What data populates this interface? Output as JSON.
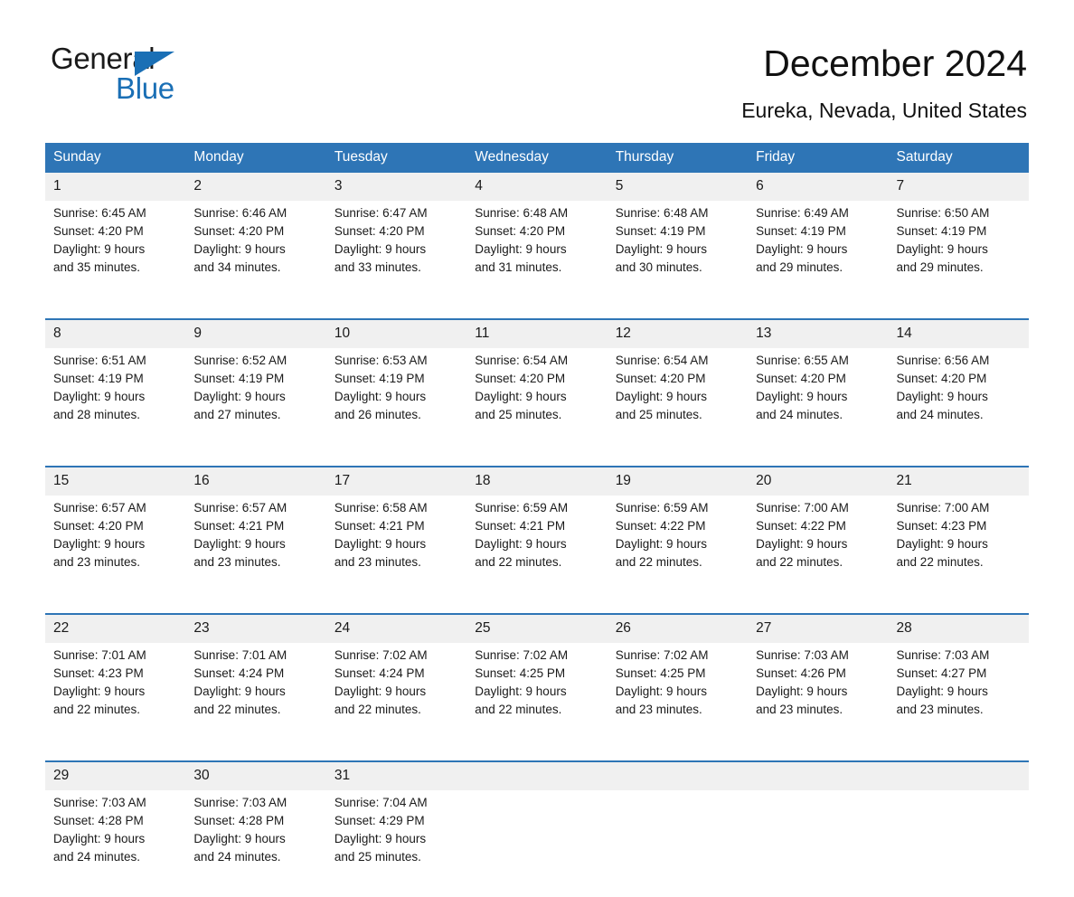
{
  "logo": {
    "word_one": "General",
    "word_two": "Blue",
    "triangle_color": "#1a6fb5"
  },
  "header": {
    "title": "December 2024",
    "subtitle": "Eureka, Nevada, United States",
    "accent_color": "#2e75b6",
    "daynum_band_color": "#f0f0f0"
  },
  "weekday_headers": [
    "Sunday",
    "Monday",
    "Tuesday",
    "Wednesday",
    "Thursday",
    "Friday",
    "Saturday"
  ],
  "weeks": [
    {
      "days": [
        {
          "number": "1",
          "sunrise": "Sunrise: 6:45 AM",
          "sunset": "Sunset: 4:20 PM",
          "daylight_1": "Daylight: 9 hours",
          "daylight_2": "and 35 minutes."
        },
        {
          "number": "2",
          "sunrise": "Sunrise: 6:46 AM",
          "sunset": "Sunset: 4:20 PM",
          "daylight_1": "Daylight: 9 hours",
          "daylight_2": "and 34 minutes."
        },
        {
          "number": "3",
          "sunrise": "Sunrise: 6:47 AM",
          "sunset": "Sunset: 4:20 PM",
          "daylight_1": "Daylight: 9 hours",
          "daylight_2": "and 33 minutes."
        },
        {
          "number": "4",
          "sunrise": "Sunrise: 6:48 AM",
          "sunset": "Sunset: 4:20 PM",
          "daylight_1": "Daylight: 9 hours",
          "daylight_2": "and 31 minutes."
        },
        {
          "number": "5",
          "sunrise": "Sunrise: 6:48 AM",
          "sunset": "Sunset: 4:19 PM",
          "daylight_1": "Daylight: 9 hours",
          "daylight_2": "and 30 minutes."
        },
        {
          "number": "6",
          "sunrise": "Sunrise: 6:49 AM",
          "sunset": "Sunset: 4:19 PM",
          "daylight_1": "Daylight: 9 hours",
          "daylight_2": "and 29 minutes."
        },
        {
          "number": "7",
          "sunrise": "Sunrise: 6:50 AM",
          "sunset": "Sunset: 4:19 PM",
          "daylight_1": "Daylight: 9 hours",
          "daylight_2": "and 29 minutes."
        }
      ]
    },
    {
      "days": [
        {
          "number": "8",
          "sunrise": "Sunrise: 6:51 AM",
          "sunset": "Sunset: 4:19 PM",
          "daylight_1": "Daylight: 9 hours",
          "daylight_2": "and 28 minutes."
        },
        {
          "number": "9",
          "sunrise": "Sunrise: 6:52 AM",
          "sunset": "Sunset: 4:19 PM",
          "daylight_1": "Daylight: 9 hours",
          "daylight_2": "and 27 minutes."
        },
        {
          "number": "10",
          "sunrise": "Sunrise: 6:53 AM",
          "sunset": "Sunset: 4:19 PM",
          "daylight_1": "Daylight: 9 hours",
          "daylight_2": "and 26 minutes."
        },
        {
          "number": "11",
          "sunrise": "Sunrise: 6:54 AM",
          "sunset": "Sunset: 4:20 PM",
          "daylight_1": "Daylight: 9 hours",
          "daylight_2": "and 25 minutes."
        },
        {
          "number": "12",
          "sunrise": "Sunrise: 6:54 AM",
          "sunset": "Sunset: 4:20 PM",
          "daylight_1": "Daylight: 9 hours",
          "daylight_2": "and 25 minutes."
        },
        {
          "number": "13",
          "sunrise": "Sunrise: 6:55 AM",
          "sunset": "Sunset: 4:20 PM",
          "daylight_1": "Daylight: 9 hours",
          "daylight_2": "and 24 minutes."
        },
        {
          "number": "14",
          "sunrise": "Sunrise: 6:56 AM",
          "sunset": "Sunset: 4:20 PM",
          "daylight_1": "Daylight: 9 hours",
          "daylight_2": "and 24 minutes."
        }
      ]
    },
    {
      "days": [
        {
          "number": "15",
          "sunrise": "Sunrise: 6:57 AM",
          "sunset": "Sunset: 4:20 PM",
          "daylight_1": "Daylight: 9 hours",
          "daylight_2": "and 23 minutes."
        },
        {
          "number": "16",
          "sunrise": "Sunrise: 6:57 AM",
          "sunset": "Sunset: 4:21 PM",
          "daylight_1": "Daylight: 9 hours",
          "daylight_2": "and 23 minutes."
        },
        {
          "number": "17",
          "sunrise": "Sunrise: 6:58 AM",
          "sunset": "Sunset: 4:21 PM",
          "daylight_1": "Daylight: 9 hours",
          "daylight_2": "and 23 minutes."
        },
        {
          "number": "18",
          "sunrise": "Sunrise: 6:59 AM",
          "sunset": "Sunset: 4:21 PM",
          "daylight_1": "Daylight: 9 hours",
          "daylight_2": "and 22 minutes."
        },
        {
          "number": "19",
          "sunrise": "Sunrise: 6:59 AM",
          "sunset": "Sunset: 4:22 PM",
          "daylight_1": "Daylight: 9 hours",
          "daylight_2": "and 22 minutes."
        },
        {
          "number": "20",
          "sunrise": "Sunrise: 7:00 AM",
          "sunset": "Sunset: 4:22 PM",
          "daylight_1": "Daylight: 9 hours",
          "daylight_2": "and 22 minutes."
        },
        {
          "number": "21",
          "sunrise": "Sunrise: 7:00 AM",
          "sunset": "Sunset: 4:23 PM",
          "daylight_1": "Daylight: 9 hours",
          "daylight_2": "and 22 minutes."
        }
      ]
    },
    {
      "days": [
        {
          "number": "22",
          "sunrise": "Sunrise: 7:01 AM",
          "sunset": "Sunset: 4:23 PM",
          "daylight_1": "Daylight: 9 hours",
          "daylight_2": "and 22 minutes."
        },
        {
          "number": "23",
          "sunrise": "Sunrise: 7:01 AM",
          "sunset": "Sunset: 4:24 PM",
          "daylight_1": "Daylight: 9 hours",
          "daylight_2": "and 22 minutes."
        },
        {
          "number": "24",
          "sunrise": "Sunrise: 7:02 AM",
          "sunset": "Sunset: 4:24 PM",
          "daylight_1": "Daylight: 9 hours",
          "daylight_2": "and 22 minutes."
        },
        {
          "number": "25",
          "sunrise": "Sunrise: 7:02 AM",
          "sunset": "Sunset: 4:25 PM",
          "daylight_1": "Daylight: 9 hours",
          "daylight_2": "and 22 minutes."
        },
        {
          "number": "26",
          "sunrise": "Sunrise: 7:02 AM",
          "sunset": "Sunset: 4:25 PM",
          "daylight_1": "Daylight: 9 hours",
          "daylight_2": "and 23 minutes."
        },
        {
          "number": "27",
          "sunrise": "Sunrise: 7:03 AM",
          "sunset": "Sunset: 4:26 PM",
          "daylight_1": "Daylight: 9 hours",
          "daylight_2": "and 23 minutes."
        },
        {
          "number": "28",
          "sunrise": "Sunrise: 7:03 AM",
          "sunset": "Sunset: 4:27 PM",
          "daylight_1": "Daylight: 9 hours",
          "daylight_2": "and 23 minutes."
        }
      ]
    },
    {
      "days": [
        {
          "number": "29",
          "sunrise": "Sunrise: 7:03 AM",
          "sunset": "Sunset: 4:28 PM",
          "daylight_1": "Daylight: 9 hours",
          "daylight_2": "and 24 minutes."
        },
        {
          "number": "30",
          "sunrise": "Sunrise: 7:03 AM",
          "sunset": "Sunset: 4:28 PM",
          "daylight_1": "Daylight: 9 hours",
          "daylight_2": "and 24 minutes."
        },
        {
          "number": "31",
          "sunrise": "Sunrise: 7:04 AM",
          "sunset": "Sunset: 4:29 PM",
          "daylight_1": "Daylight: 9 hours",
          "daylight_2": "and 25 minutes."
        },
        {
          "number": "",
          "sunrise": "",
          "sunset": "",
          "daylight_1": "",
          "daylight_2": ""
        },
        {
          "number": "",
          "sunrise": "",
          "sunset": "",
          "daylight_1": "",
          "daylight_2": ""
        },
        {
          "number": "",
          "sunrise": "",
          "sunset": "",
          "daylight_1": "",
          "daylight_2": ""
        },
        {
          "number": "",
          "sunrise": "",
          "sunset": "",
          "daylight_1": "",
          "daylight_2": ""
        }
      ]
    }
  ]
}
